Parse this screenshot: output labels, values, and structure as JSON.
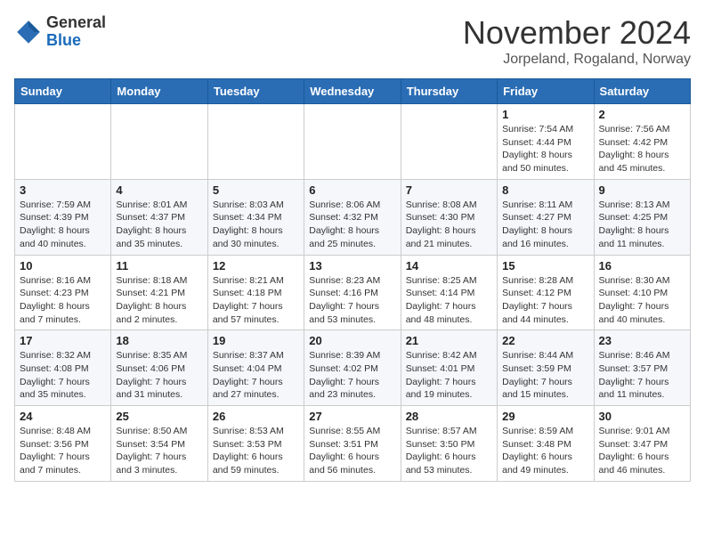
{
  "logo": {
    "general": "General",
    "blue": "Blue"
  },
  "title": "November 2024",
  "location": "Jorpeland, Rogaland, Norway",
  "days_of_week": [
    "Sunday",
    "Monday",
    "Tuesday",
    "Wednesday",
    "Thursday",
    "Friday",
    "Saturday"
  ],
  "weeks": [
    [
      {
        "day": "",
        "info": ""
      },
      {
        "day": "",
        "info": ""
      },
      {
        "day": "",
        "info": ""
      },
      {
        "day": "",
        "info": ""
      },
      {
        "day": "",
        "info": ""
      },
      {
        "day": "1",
        "info": "Sunrise: 7:54 AM\nSunset: 4:44 PM\nDaylight: 8 hours and 50 minutes."
      },
      {
        "day": "2",
        "info": "Sunrise: 7:56 AM\nSunset: 4:42 PM\nDaylight: 8 hours and 45 minutes."
      }
    ],
    [
      {
        "day": "3",
        "info": "Sunrise: 7:59 AM\nSunset: 4:39 PM\nDaylight: 8 hours and 40 minutes."
      },
      {
        "day": "4",
        "info": "Sunrise: 8:01 AM\nSunset: 4:37 PM\nDaylight: 8 hours and 35 minutes."
      },
      {
        "day": "5",
        "info": "Sunrise: 8:03 AM\nSunset: 4:34 PM\nDaylight: 8 hours and 30 minutes."
      },
      {
        "day": "6",
        "info": "Sunrise: 8:06 AM\nSunset: 4:32 PM\nDaylight: 8 hours and 25 minutes."
      },
      {
        "day": "7",
        "info": "Sunrise: 8:08 AM\nSunset: 4:30 PM\nDaylight: 8 hours and 21 minutes."
      },
      {
        "day": "8",
        "info": "Sunrise: 8:11 AM\nSunset: 4:27 PM\nDaylight: 8 hours and 16 minutes."
      },
      {
        "day": "9",
        "info": "Sunrise: 8:13 AM\nSunset: 4:25 PM\nDaylight: 8 hours and 11 minutes."
      }
    ],
    [
      {
        "day": "10",
        "info": "Sunrise: 8:16 AM\nSunset: 4:23 PM\nDaylight: 8 hours and 7 minutes."
      },
      {
        "day": "11",
        "info": "Sunrise: 8:18 AM\nSunset: 4:21 PM\nDaylight: 8 hours and 2 minutes."
      },
      {
        "day": "12",
        "info": "Sunrise: 8:21 AM\nSunset: 4:18 PM\nDaylight: 7 hours and 57 minutes."
      },
      {
        "day": "13",
        "info": "Sunrise: 8:23 AM\nSunset: 4:16 PM\nDaylight: 7 hours and 53 minutes."
      },
      {
        "day": "14",
        "info": "Sunrise: 8:25 AM\nSunset: 4:14 PM\nDaylight: 7 hours and 48 minutes."
      },
      {
        "day": "15",
        "info": "Sunrise: 8:28 AM\nSunset: 4:12 PM\nDaylight: 7 hours and 44 minutes."
      },
      {
        "day": "16",
        "info": "Sunrise: 8:30 AM\nSunset: 4:10 PM\nDaylight: 7 hours and 40 minutes."
      }
    ],
    [
      {
        "day": "17",
        "info": "Sunrise: 8:32 AM\nSunset: 4:08 PM\nDaylight: 7 hours and 35 minutes."
      },
      {
        "day": "18",
        "info": "Sunrise: 8:35 AM\nSunset: 4:06 PM\nDaylight: 7 hours and 31 minutes."
      },
      {
        "day": "19",
        "info": "Sunrise: 8:37 AM\nSunset: 4:04 PM\nDaylight: 7 hours and 27 minutes."
      },
      {
        "day": "20",
        "info": "Sunrise: 8:39 AM\nSunset: 4:02 PM\nDaylight: 7 hours and 23 minutes."
      },
      {
        "day": "21",
        "info": "Sunrise: 8:42 AM\nSunset: 4:01 PM\nDaylight: 7 hours and 19 minutes."
      },
      {
        "day": "22",
        "info": "Sunrise: 8:44 AM\nSunset: 3:59 PM\nDaylight: 7 hours and 15 minutes."
      },
      {
        "day": "23",
        "info": "Sunrise: 8:46 AM\nSunset: 3:57 PM\nDaylight: 7 hours and 11 minutes."
      }
    ],
    [
      {
        "day": "24",
        "info": "Sunrise: 8:48 AM\nSunset: 3:56 PM\nDaylight: 7 hours and 7 minutes."
      },
      {
        "day": "25",
        "info": "Sunrise: 8:50 AM\nSunset: 3:54 PM\nDaylight: 7 hours and 3 minutes."
      },
      {
        "day": "26",
        "info": "Sunrise: 8:53 AM\nSunset: 3:53 PM\nDaylight: 6 hours and 59 minutes."
      },
      {
        "day": "27",
        "info": "Sunrise: 8:55 AM\nSunset: 3:51 PM\nDaylight: 6 hours and 56 minutes."
      },
      {
        "day": "28",
        "info": "Sunrise: 8:57 AM\nSunset: 3:50 PM\nDaylight: 6 hours and 53 minutes."
      },
      {
        "day": "29",
        "info": "Sunrise: 8:59 AM\nSunset: 3:48 PM\nDaylight: 6 hours and 49 minutes."
      },
      {
        "day": "30",
        "info": "Sunrise: 9:01 AM\nSunset: 3:47 PM\nDaylight: 6 hours and 46 minutes."
      }
    ]
  ]
}
